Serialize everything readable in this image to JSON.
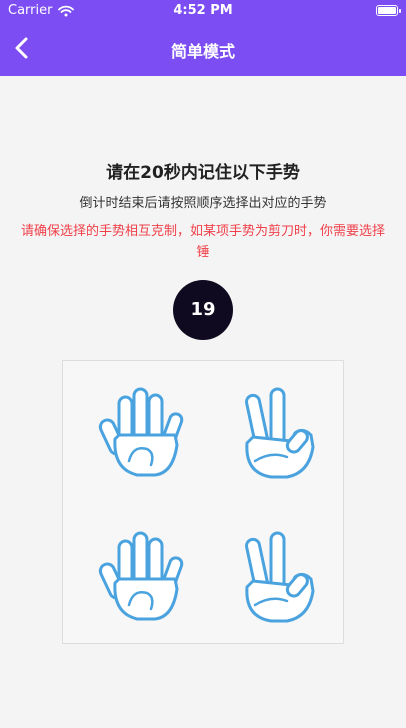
{
  "status_bar": {
    "carrier": "Carrier",
    "time": "4:52 PM",
    "wifi_icon": "wifi-icon",
    "battery_icon": "battery-icon"
  },
  "nav": {
    "back_icon": "chevron-left-icon",
    "title": "简单模式"
  },
  "content": {
    "heading": "请在20秒内记住以下手势",
    "subtitle": "倒计时结束后请按照顺序选择出对应的手势",
    "warning": "请确保选择的手势相互克制，如某项手势为剪刀时，你需要选择锤",
    "countdown": "19",
    "gestures": [
      {
        "name": "paper",
        "icon": "open-hand-icon"
      },
      {
        "name": "scissors",
        "icon": "victory-hand-icon"
      },
      {
        "name": "paper",
        "icon": "open-hand-icon"
      },
      {
        "name": "scissors",
        "icon": "victory-hand-icon"
      }
    ]
  },
  "colors": {
    "header": "#7b4df2",
    "warning": "#f0404a",
    "timer_bg": "#0f0a1f",
    "hand_outline": "#4aa3df"
  }
}
